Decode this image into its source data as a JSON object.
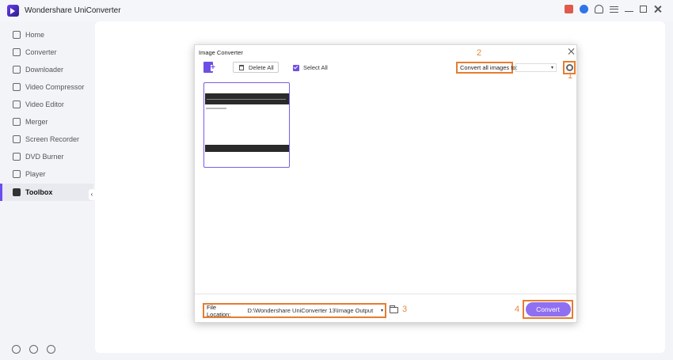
{
  "app": {
    "title": "Wondershare UniConverter"
  },
  "sidebar": {
    "items": [
      {
        "label": "Home",
        "icon": "home-icon"
      },
      {
        "label": "Converter",
        "icon": "converter-icon"
      },
      {
        "label": "Downloader",
        "icon": "downloader-icon"
      },
      {
        "label": "Video Compressor",
        "icon": "compress-icon"
      },
      {
        "label": "Video Editor",
        "icon": "scissors-icon"
      },
      {
        "label": "Merger",
        "icon": "merge-icon"
      },
      {
        "label": "Screen Recorder",
        "icon": "record-icon"
      },
      {
        "label": "DVD Burner",
        "icon": "disc-icon"
      },
      {
        "label": "Player",
        "icon": "play-icon"
      },
      {
        "label": "Toolbox",
        "icon": "grid-icon"
      }
    ],
    "active": "Toolbox",
    "collapse_glyph": "‹"
  },
  "dialog": {
    "title": "Image Converter",
    "delete_all": "Delete All",
    "select_all": "Select All",
    "convert_all_to": "Convert all images to:",
    "format_value": "",
    "format_chevron": "▾",
    "file_location_label": "File Location:",
    "file_location_path": "D:\\Wondershare UniConverter 13\\Image Output",
    "path_chevron": "▾",
    "convert": "Convert"
  },
  "annotations": {
    "n1": "1",
    "n2": "2",
    "n3": "3",
    "n4": "4"
  },
  "colors": {
    "accent": "#6e4fe4",
    "annotation": "#e87c2e",
    "convert_button": "#8f6ff2"
  }
}
